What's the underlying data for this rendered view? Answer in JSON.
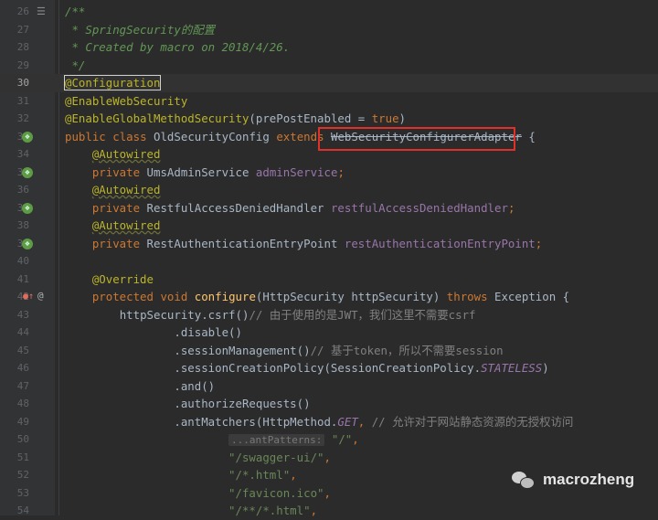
{
  "lines": [
    {
      "n": "26",
      "kind": "doc-open",
      "text": "/**"
    },
    {
      "n": "27",
      "kind": "doc",
      "text": " * SpringSecurity的配置"
    },
    {
      "n": "28",
      "kind": "doc",
      "text": " * Created by macro on 2018/4/26."
    },
    {
      "n": "29",
      "kind": "doc",
      "text": " */"
    },
    {
      "n": "30",
      "text": "@Configuration"
    },
    {
      "n": "31",
      "text": "@EnableWebSecurity"
    },
    {
      "n": "32",
      "text": "@EnableGlobalMethodSecurity(prePostEnabled = true)"
    },
    {
      "n": "33",
      "text": "public class OldSecurityConfig extends WebSecurityConfigurerAdapter {"
    },
    {
      "n": "34",
      "text": "@Autowired"
    },
    {
      "n": "35",
      "text": "private UmsAdminService adminService;"
    },
    {
      "n": "36",
      "text": "@Autowired"
    },
    {
      "n": "37",
      "text": "private RestfulAccessDeniedHandler restfulAccessDeniedHandler;"
    },
    {
      "n": "38",
      "text": "@Autowired"
    },
    {
      "n": "39",
      "text": "private RestAuthenticationEntryPoint restAuthenticationEntryPoint;"
    },
    {
      "n": "40",
      "text": ""
    },
    {
      "n": "41",
      "text": "@Override"
    },
    {
      "n": "42",
      "text": "protected void configure(HttpSecurity httpSecurity) throws Exception {"
    },
    {
      "n": "43",
      "text": "httpSecurity.csrf()// 由于使用的是JWT，我们这里不需要csrf"
    },
    {
      "n": "44",
      "text": ".disable()"
    },
    {
      "n": "45",
      "text": ".sessionManagement()// 基于token，所以不需要session"
    },
    {
      "n": "46",
      "text": ".sessionCreationPolicy(SessionCreationPolicy.STATELESS)"
    },
    {
      "n": "47",
      "text": ".and()"
    },
    {
      "n": "48",
      "text": ".authorizeRequests()"
    },
    {
      "n": "49",
      "text": ".antMatchers(HttpMethod.GET, // 允许对于网站静态资源的无授权访问"
    },
    {
      "n": "50",
      "text": "...antPatterns: \"/\","
    },
    {
      "n": "51",
      "text": "\"/swagger-ui/\","
    },
    {
      "n": "52",
      "text": "\"/*.html\","
    },
    {
      "n": "53",
      "text": "\"/favicon.ico\","
    },
    {
      "n": "54",
      "text": "\"/**/*.html\","
    }
  ],
  "tokens": {
    "doc_open": "/**",
    "doc_27": " * SpringSecurity的配置",
    "doc_28": " * Created by macro on 2018/4/26.",
    "doc_29": " */",
    "a_config": "@Configuration",
    "a_enableweb": "@EnableWebSecurity",
    "a_enableglobal": "@EnableGlobalMethodSecurity",
    "l32_mid": "(prePostEnabled = ",
    "kw_true": "true",
    "paren_close": ")",
    "kw_public": "public",
    "kw_class": "class",
    "class_name": "OldSecurityConfig",
    "kw_extends": "extends",
    "superclass": "WebSecurityConfigurerAdapter",
    "brace_open": "{",
    "a_autowired": "@Autowired",
    "kw_private": "private",
    "t_admin_service": "UmsAdminService",
    "f_admin_service": "adminService",
    "t_denied": "RestfulAccessDeniedHandler",
    "f_denied": "restfulAccessDeniedHandler",
    "t_entry": "RestAuthenticationEntryPoint",
    "f_entry": "restAuthenticationEntryPoint",
    "semicolon": ";",
    "a_override": "@Override",
    "kw_protected": "protected",
    "kw_void": "void",
    "m_configure": "configure",
    "p_configure": "(HttpSecurity httpSecurity) ",
    "kw_throws": "throws",
    "t_exception": "Exception",
    "c43": "httpSecurity.csrf()",
    "cm43": "// 由于使用的是JWT，我们这里不需要csrf",
    "c44": ".disable()",
    "c45": ".sessionManagement()",
    "cm45": "// 基于token，所以不需要session",
    "c46a": ".sessionCreationPolicy(SessionCreationPolicy.",
    "c46_static": "STATELESS",
    "c47": ".and()",
    "c48": ".authorizeRequests()",
    "c49a": ".antMatchers(HttpMethod.",
    "c49_static": "GET",
    "comma": ", ",
    "cm49": "// 允许对于网站静态资源的无授权访问",
    "hint50": "...antPatterns:",
    "s50": "\"/\"",
    "s51": "\"/swagger-ui/\"",
    "s52": "\"/*.html\"",
    "s53": "\"/favicon.ico\"",
    "s54": "\"/**/*.html\"",
    "comma_only": ","
  },
  "gutter_icons": {
    "l26": "list-icon",
    "l33": "spring-bean-icon",
    "l35": "spring-bean-icon",
    "l37": "spring-bean-icon",
    "l39": "spring-bean-icon",
    "l42a": "override-icon",
    "l42b": "at-icon"
  },
  "watermark": {
    "text": "macrozheng"
  },
  "colors": {
    "background": "#2b2b2b",
    "keyword": "#cc7832",
    "annotation": "#bbb529",
    "doc_comment": "#629755",
    "comment": "#808080",
    "field": "#9876aa",
    "string": "#6a8759",
    "highlight_box": "#e0302a"
  }
}
